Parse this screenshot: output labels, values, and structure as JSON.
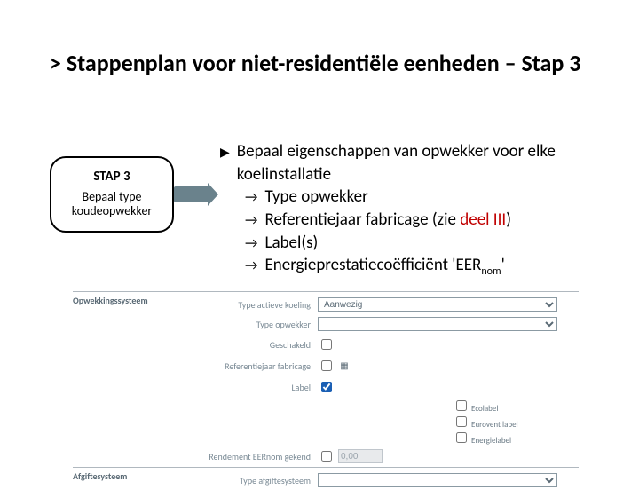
{
  "title": "> Stappenplan voor niet-residentiële eenheden – Stap 3",
  "step": {
    "label": "STAP 3",
    "desc1": "Bepaal type",
    "desc2": "koudeopwekker"
  },
  "bullet": {
    "lead": "Bepaal eigenschappen van opwekker voor elke koelinstallatie",
    "s1": "Type opwekker",
    "s2a": "Referentiejaar fabricage (zie ",
    "s2b": "deel III",
    "s2c": ")",
    "s3": "Label(s)",
    "s4a": "Energieprestatiecoëfficiënt 'EER",
    "s4b": "nom",
    "s4c": "'"
  },
  "form": {
    "sec1": "Opwekkingssysteem",
    "f1_label": "Type actieve koeling",
    "f1_value": "Aanwezig",
    "f2_label": "Type opwekker",
    "f3_label": "Geschakeld",
    "f4_label": "Referentiejaar fabricage",
    "f5_label": "Label",
    "lab1": "Ecolabel",
    "lab2": "Eurovent label",
    "lab3": "Energielabel",
    "f6_label": "Rendement EERnom gekend",
    "f6_value": "0,00",
    "sec2": "Afgiftesysteem",
    "f7_label": "Type afgiftesysteem"
  }
}
